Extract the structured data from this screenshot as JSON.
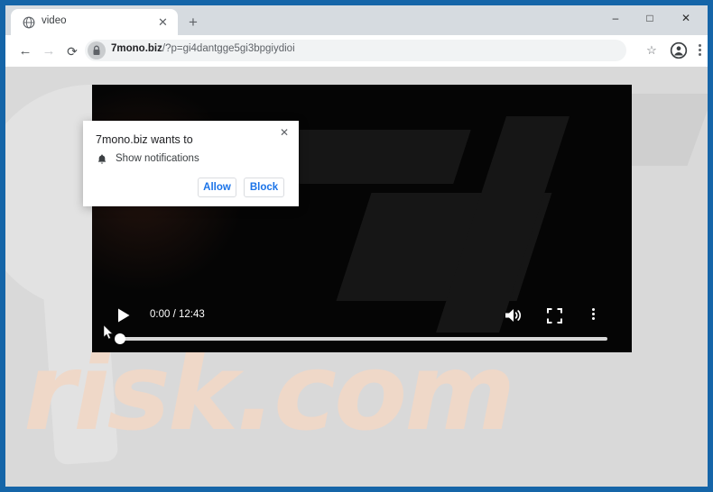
{
  "window": {
    "controls": {
      "minimize": "–",
      "maximize": "□",
      "close": "✕"
    },
    "border_color": "#1565a8"
  },
  "tab_strip": {
    "tabs": [
      {
        "title": "video",
        "favicon": "globe-icon",
        "close_label": "✕"
      }
    ],
    "new_tab_label": "+"
  },
  "toolbar": {
    "back_label": "←",
    "forward_label": "→",
    "reload_label": "⟳",
    "omnibox": {
      "lock_icon": "lock-icon",
      "host": "7mono.biz",
      "path": "/?p=gi4dantgge5gi3bpgiydioi",
      "full_url": "7mono.biz/?p=gi4dantgge5gi3bpgiydioi"
    },
    "bookmark_label": "☆",
    "profile_icon": "account-circle-icon",
    "menu_icon": "three-dot-menu-icon"
  },
  "permission_dialog": {
    "title": "7mono.biz wants to",
    "item_icon": "bell-icon",
    "item_label": "Show notifications",
    "allow_label": "Allow",
    "block_label": "Block",
    "close_label": "✕",
    "accent_color": "#1a73e8"
  },
  "video_player": {
    "play_label": "play-icon",
    "current_time": "0:00",
    "duration": "12:43",
    "time_display": "0:00 / 12:43",
    "volume_icon": "volume-high-icon",
    "fullscreen_icon": "fullscreen-icon",
    "menu_icon": "three-dot-menu-icon",
    "progress_percent": 0
  },
  "page_background": {
    "watermark_text": "risk.com",
    "watermark_color": "#efd8c8",
    "background_color": "#d9d9d9"
  }
}
